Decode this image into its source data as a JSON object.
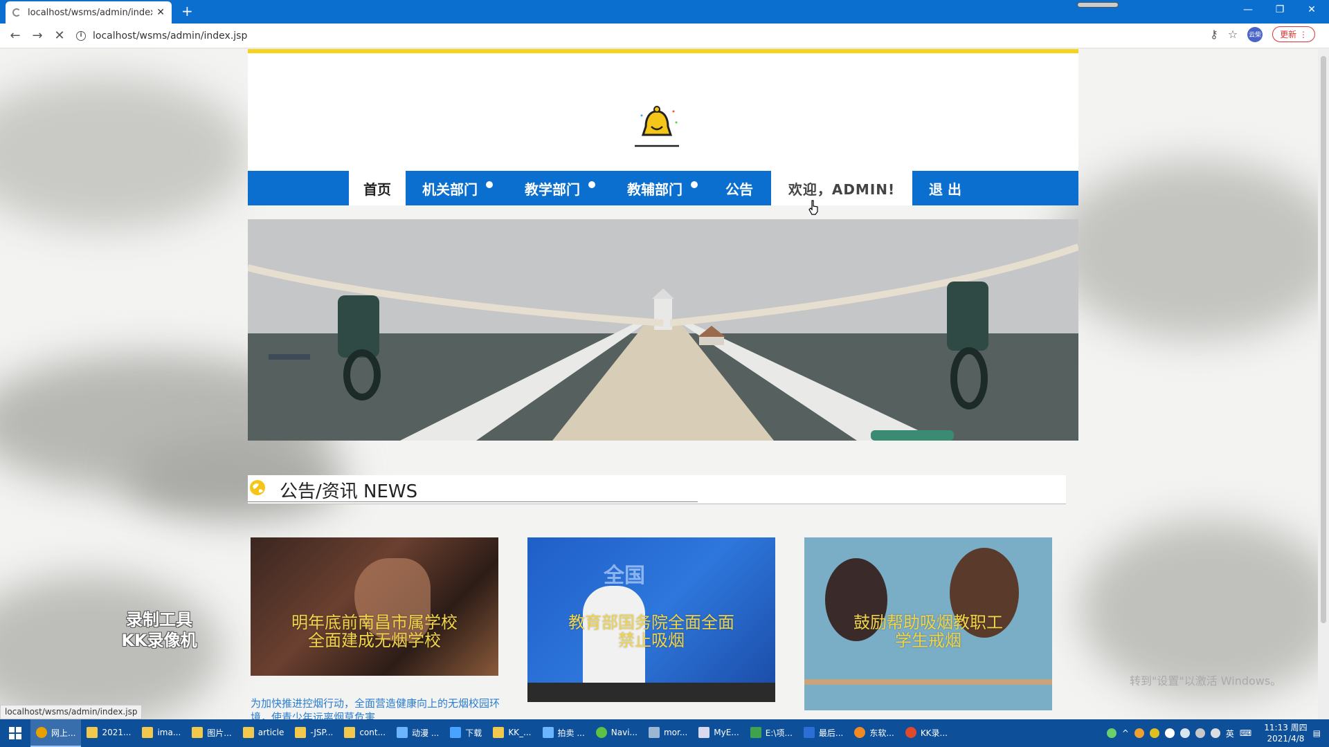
{
  "browser": {
    "tab_title": "localhost/wsms/admin/index.j",
    "url": "localhost/wsms/admin/index.jsp",
    "update_label": "更新",
    "profile_label": "云柴"
  },
  "nav": {
    "home": "首页",
    "items": [
      "机关部门",
      "教学部门",
      "教辅部门"
    ],
    "notice": "公告",
    "welcome": "欢迎，ADMIN!",
    "logout": "退 出"
  },
  "news": {
    "title": "公告/资讯 NEWS",
    "cards": [
      {
        "caption_line1": "明年底前南昌市属学校",
        "caption_line2": "全面建成无烟学校"
      },
      {
        "caption_line1": "教育部国务院全面全面",
        "caption_line2": "禁止吸烟",
        "img_text": "全国"
      },
      {
        "caption_line1": "鼓励帮助吸烟教职工",
        "caption_line2": "学生戒烟"
      }
    ],
    "desc": "为加快推进控烟行动，全面营造健康向上的无烟校园环境，使青少年远离烟草危害"
  },
  "overlay": {
    "watermark_line1": "录制工具",
    "watermark_line2": "KK录像机",
    "activate": "转到\"设置\"以激活 Windows。",
    "status_url": "localhost/wsms/admin/index.jsp"
  },
  "taskbar": {
    "items": [
      "网上...",
      "2021...",
      "ima...",
      "图片...",
      "article",
      "-JSP...",
      "cont...",
      "动漫 ...",
      "下载",
      "KK_...",
      "拍卖 ...",
      "Navi...",
      "mor...",
      "MyE...",
      "E:\\项...",
      "最后...",
      "东软...",
      "KK录..."
    ],
    "ime": "英",
    "time": "11:13 周四",
    "date": "2021/4/8"
  },
  "colors": {
    "nav_blue": "#0b6fd0",
    "accent_yellow": "#f5d31a",
    "caption_yellow": "#f0d54a",
    "link_blue": "#2a7dd1"
  }
}
